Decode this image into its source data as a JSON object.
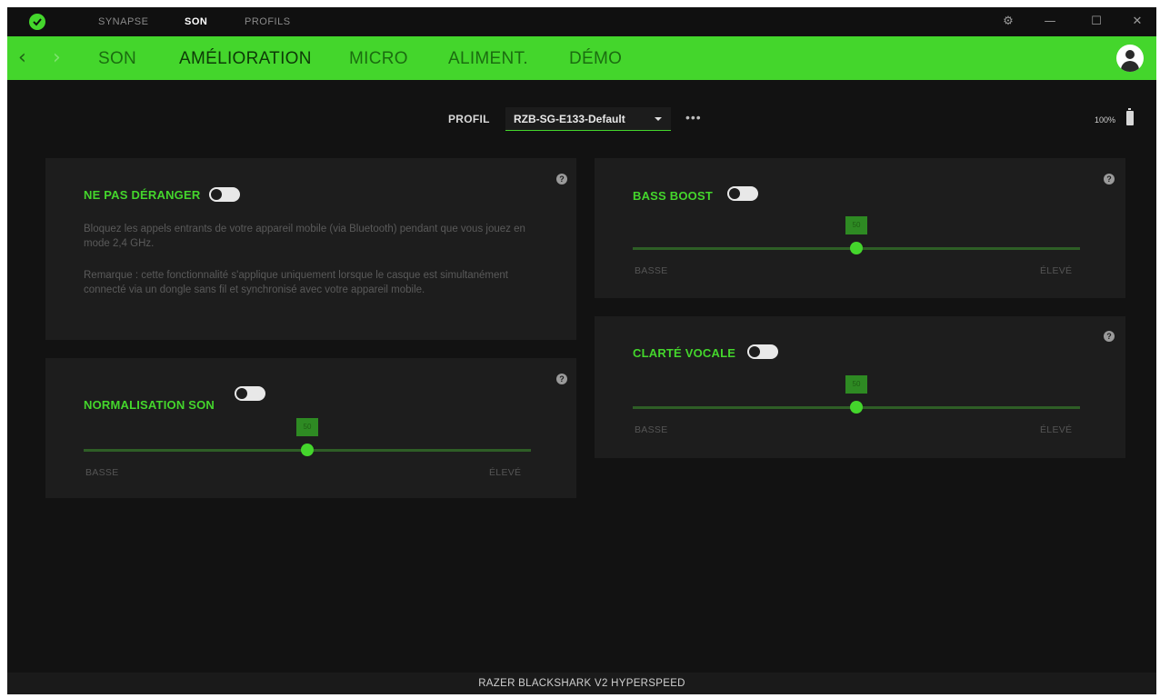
{
  "top_tabs": [
    {
      "label": "SYNAPSE"
    },
    {
      "label": "SON"
    },
    {
      "label": "PROFILS"
    }
  ],
  "nav_tabs": [
    {
      "label": "SON"
    },
    {
      "label": "AMÉLIORATION"
    },
    {
      "label": "MICRO"
    },
    {
      "label": "ALIMENT."
    },
    {
      "label": "DÉMO"
    }
  ],
  "window_controls": {
    "settings": "⚙",
    "minimize": "—",
    "maximize": "☐",
    "close": "✕"
  },
  "profile": {
    "label": "PROFIL",
    "selected": "RZB-SG-E133-Default",
    "more": "•••"
  },
  "battery": {
    "text": "100%",
    "level": 1.0
  },
  "panels": {
    "do_not_disturb": {
      "title": "NE PAS DÉRANGER",
      "enabled": false,
      "description": "Bloquez les appels entrants de votre appareil mobile (via Bluetooth) pendant que vous jouez en mode 2,4 GHz.",
      "note": "Remarque : cette fonctionnalité s'applique uniquement lorsque le casque est simultanément connecté via un dongle sans fil et synchronisé avec votre appareil mobile."
    },
    "normalization": {
      "title": "NORMALISATION SON",
      "enabled": false,
      "slider_value": 0.5,
      "badge": "50",
      "low_label": "BASSE",
      "high_label": "ÉLEVÉ"
    },
    "bass_boost": {
      "title": "BASS BOOST",
      "enabled": false,
      "slider_value": 0.5,
      "badge": "50",
      "low_label": "BASSE",
      "high_label": "ÉLEVÉ"
    },
    "voice_clarity": {
      "title": "CLARTÉ VOCALE",
      "enabled": false,
      "slider_value": 0.5,
      "badge": "50",
      "low_label": "BASSE",
      "high_label": "ÉLEVÉ"
    }
  },
  "help_glyph": "?",
  "device_name": "RAZER BLACKSHARK V2 HYPERSPEED",
  "colors": {
    "accent": "#44d62c",
    "background": "#121212",
    "panel": "#1d1d1d"
  }
}
